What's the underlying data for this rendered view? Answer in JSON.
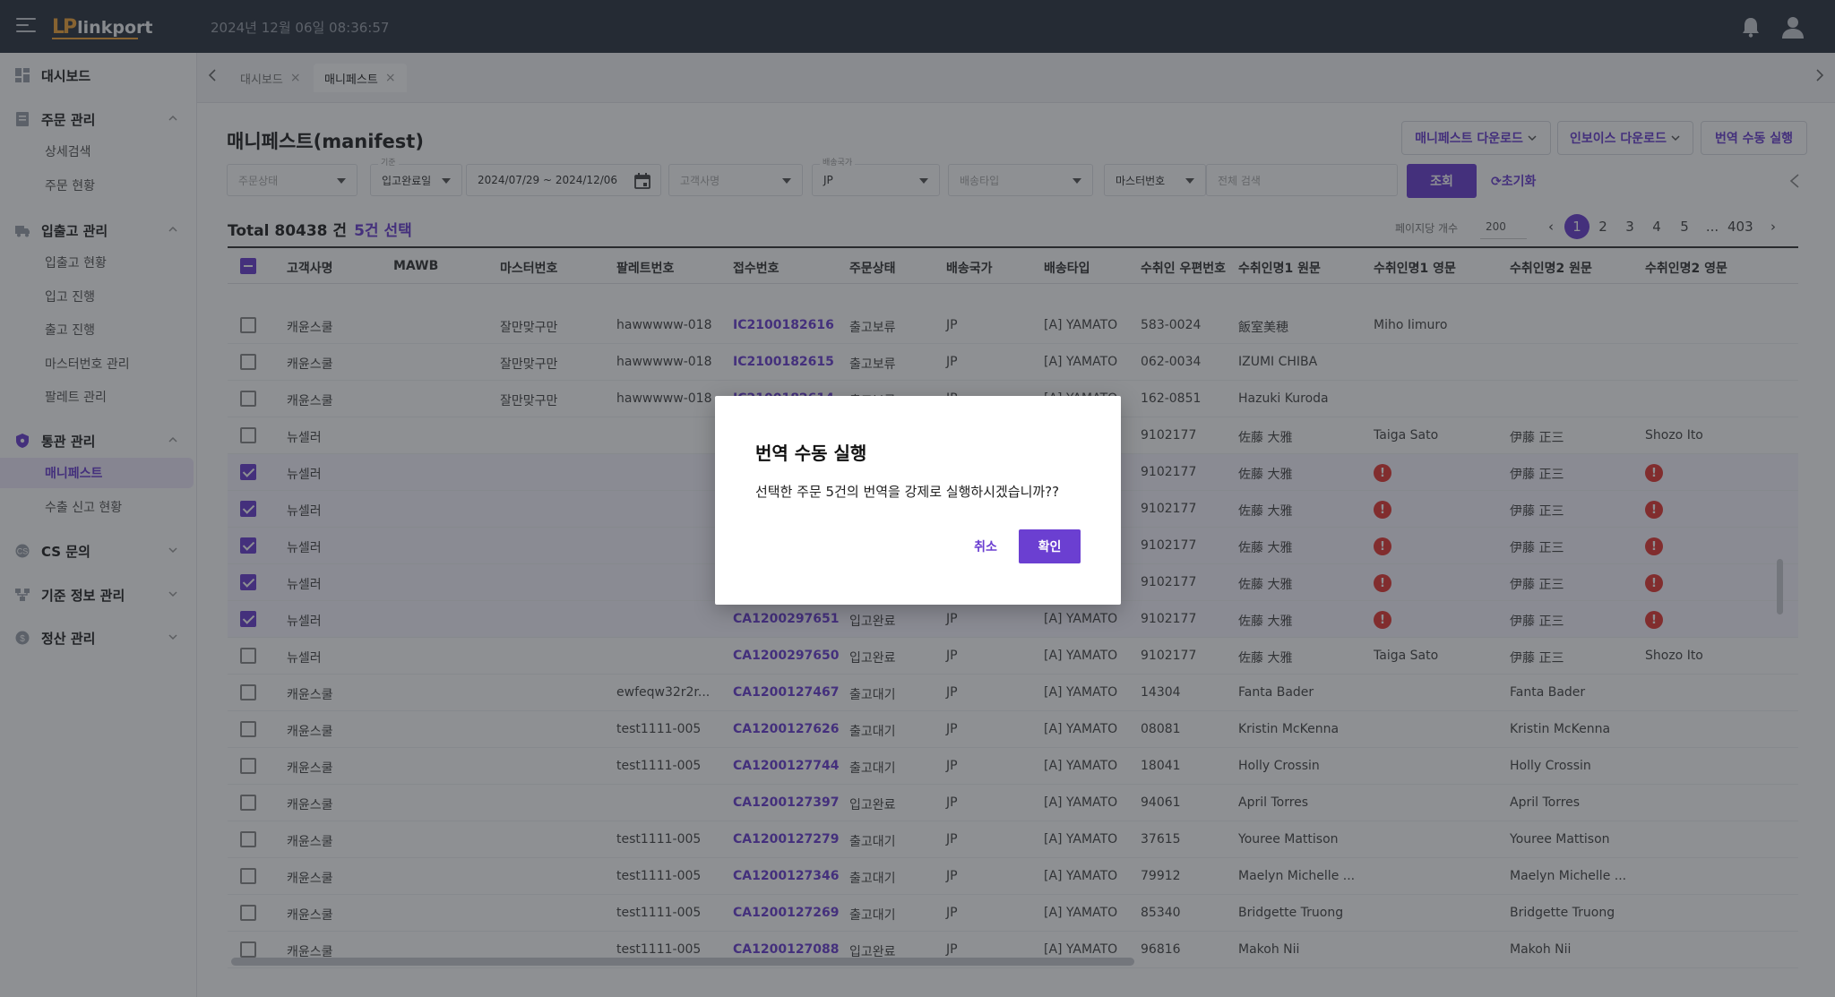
{
  "header": {
    "logo_mark": "LP",
    "logo_text": "linkport",
    "datetime": "2024년 12월 06일 08:36:57"
  },
  "sidebar": {
    "groups": [
      {
        "label": "대시보드",
        "icon": "dashboard-icon"
      },
      {
        "label": "주문 관리",
        "icon": "order-icon",
        "subs": [
          "상세검색",
          "주문 현황"
        ]
      },
      {
        "label": "입출고 관리",
        "icon": "truck-icon",
        "subs": [
          "입출고 현황",
          "입고 진행",
          "출고 진행",
          "마스터번호 관리",
          "팔레트 관리"
        ]
      },
      {
        "label": "통관 관리",
        "icon": "shield-icon",
        "subs": [
          "매니페스트",
          "수출 신고 현황"
        ]
      },
      {
        "label": "CS 문의",
        "icon": "cs-icon"
      },
      {
        "label": "기준 정보 관리",
        "icon": "settings-icon"
      },
      {
        "label": "정산 관리",
        "icon": "money-icon"
      }
    ]
  },
  "tabs": [
    {
      "label": "대시보드"
    },
    {
      "label": "매니페스트"
    }
  ],
  "page": {
    "title": "매니페스트(manifest)",
    "btn_manifest_download": "매니페스트 다운로드",
    "btn_invoice_download": "인보이스 다운로드",
    "btn_manual_translate": "번역 수동 실행"
  },
  "filters": {
    "order_status_placeholder": "주문상태",
    "date_type_label": "기준",
    "date_type": "입고완료일",
    "date_range": "2024/07/29 ~ 2024/12/06",
    "customer_placeholder": "고객사명",
    "country_label": "배송국가",
    "country": "JP",
    "delivery_type_placeholder": "배송타입",
    "search_field": "마스터번호",
    "search_placeholder": "전체 검색",
    "search_button": "조회",
    "reset_button": "초기화"
  },
  "summary": {
    "total": "Total 80438 건",
    "selected": "5건 선택"
  },
  "pagination": {
    "per_page_label": "페이지당 개수",
    "per_page": "200",
    "pages": [
      "1",
      "2",
      "3",
      "4",
      "5",
      "...",
      "403"
    ],
    "current": "1"
  },
  "table": {
    "columns": [
      "고객사명",
      "MAWB",
      "마스터번호",
      "팔레트번호",
      "접수번호",
      "주문상태",
      "배송국가",
      "배송타입",
      "수취인 우편번호",
      "수취인명1 원문",
      "수취인명1 영문",
      "수취인명2 원문",
      "수취인명2 영문"
    ],
    "rows": [
      {
        "checked": false,
        "customer": "캐윤스쿨",
        "master": "잘만맞구만",
        "pallet": "hawwwww-018",
        "receipt": "IC2100182616",
        "status": "출고보류",
        "country": "JP",
        "type": "[A] YAMATO",
        "zip": "583-0024",
        "name1": "飯室美穂",
        "name1_en": "Miho Iimuro",
        "name2": "",
        "name2_en": ""
      },
      {
        "checked": false,
        "customer": "캐윤스쿨",
        "master": "잘만맞구만",
        "pallet": "hawwwww-018",
        "receipt": "IC2100182615",
        "status": "출고보류",
        "country": "JP",
        "type": "[A] YAMATO",
        "zip": "062-0034",
        "name1": "IZUMI CHIBA",
        "name1_en": "",
        "name2": "",
        "name2_en": ""
      },
      {
        "checked": false,
        "customer": "캐윤스쿨",
        "master": "잘만맞구만",
        "pallet": "hawwwww-018",
        "receipt": "IC2100182614",
        "status": "출고보류",
        "country": "JP",
        "type": "[A] YAMATO",
        "zip": "162-0851",
        "name1": "Hazuki Kuroda",
        "name1_en": "",
        "name2": "",
        "name2_en": ""
      },
      {
        "checked": false,
        "customer": "뉴셀러",
        "master": "",
        "pallet": "",
        "receipt": "",
        "status": "",
        "country": "",
        "type": "",
        "zip": "9102177",
        "name1": "佐藤 大雅",
        "name1_en": "Taiga Sato",
        "name2": "伊藤 正三",
        "name2_en": "Shozo Ito"
      },
      {
        "checked": true,
        "customer": "뉴셀러",
        "master": "",
        "pallet": "",
        "receipt": "",
        "status": "",
        "country": "",
        "type": "",
        "zip": "9102177",
        "name1": "佐藤 大雅",
        "name1_en": "!",
        "name2": "伊藤 正三",
        "name2_en": "!"
      },
      {
        "checked": true,
        "customer": "뉴셀러",
        "master": "",
        "pallet": "",
        "receipt": "",
        "status": "",
        "country": "",
        "type": "",
        "zip": "9102177",
        "name1": "佐藤 大雅",
        "name1_en": "!",
        "name2": "伊藤 正三",
        "name2_en": "!"
      },
      {
        "checked": true,
        "customer": "뉴셀러",
        "master": "",
        "pallet": "",
        "receipt": "",
        "status": "",
        "country": "",
        "type": "",
        "zip": "9102177",
        "name1": "佐藤 大雅",
        "name1_en": "!",
        "name2": "伊藤 正三",
        "name2_en": "!"
      },
      {
        "checked": true,
        "customer": "뉴셀러",
        "master": "",
        "pallet": "",
        "receipt": "",
        "status": "",
        "country": "",
        "type": "",
        "zip": "9102177",
        "name1": "佐藤 大雅",
        "name1_en": "!",
        "name2": "伊藤 正三",
        "name2_en": "!"
      },
      {
        "checked": true,
        "customer": "뉴셀러",
        "master": "",
        "pallet": "",
        "receipt": "CA1200297651",
        "status": "입고완료",
        "country": "JP",
        "type": "[A] YAMATO",
        "zip": "9102177",
        "name1": "佐藤 大雅",
        "name1_en": "!",
        "name2": "伊藤 正三",
        "name2_en": "!"
      },
      {
        "checked": false,
        "customer": "뉴셀러",
        "master": "",
        "pallet": "",
        "receipt": "CA1200297650",
        "status": "입고완료",
        "country": "JP",
        "type": "[A] YAMATO",
        "zip": "9102177",
        "name1": "佐藤 大雅",
        "name1_en": "Taiga Sato",
        "name2": "伊藤 正三",
        "name2_en": "Shozo Ito"
      },
      {
        "checked": false,
        "customer": "캐윤스쿨",
        "master": "",
        "pallet": "ewfeqw32r2r...",
        "receipt": "CA1200127467",
        "status": "출고대기",
        "country": "JP",
        "type": "[A] YAMATO",
        "zip": "14304",
        "name1": "Fanta Bader",
        "name1_en": "",
        "name2": "Fanta Bader",
        "name2_en": ""
      },
      {
        "checked": false,
        "customer": "캐윤스쿨",
        "master": "",
        "pallet": "test1111-005",
        "receipt": "CA1200127626",
        "status": "출고대기",
        "country": "JP",
        "type": "[A] YAMATO",
        "zip": "08081",
        "name1": "Kristin McKenna",
        "name1_en": "",
        "name2": "Kristin McKenna",
        "name2_en": ""
      },
      {
        "checked": false,
        "customer": "캐윤스쿨",
        "master": "",
        "pallet": "test1111-005",
        "receipt": "CA1200127744",
        "status": "출고대기",
        "country": "JP",
        "type": "[A] YAMATO",
        "zip": "18041",
        "name1": "Holly Crossin",
        "name1_en": "",
        "name2": "Holly Crossin",
        "name2_en": ""
      },
      {
        "checked": false,
        "customer": "캐윤스쿨",
        "master": "",
        "pallet": "",
        "receipt": "CA1200127397",
        "status": "입고완료",
        "country": "JP",
        "type": "[A] YAMATO",
        "zip": "94061",
        "name1": "April Torres",
        "name1_en": "",
        "name2": "April Torres",
        "name2_en": ""
      },
      {
        "checked": false,
        "customer": "캐윤스쿨",
        "master": "",
        "pallet": "test1111-005",
        "receipt": "CA1200127279",
        "status": "출고대기",
        "country": "JP",
        "type": "[A] YAMATO",
        "zip": "37615",
        "name1": "Youree Mattison",
        "name1_en": "",
        "name2": "Youree Mattison",
        "name2_en": ""
      },
      {
        "checked": false,
        "customer": "캐윤스쿨",
        "master": "",
        "pallet": "test1111-005",
        "receipt": "CA1200127346",
        "status": "출고대기",
        "country": "JP",
        "type": "[A] YAMATO",
        "zip": "79912",
        "name1": "Maelyn Michelle ...",
        "name1_en": "",
        "name2": "Maelyn Michelle ...",
        "name2_en": ""
      },
      {
        "checked": false,
        "customer": "캐윤스쿨",
        "master": "",
        "pallet": "test1111-005",
        "receipt": "CA1200127269",
        "status": "출고대기",
        "country": "JP",
        "type": "[A] YAMATO",
        "zip": "85340",
        "name1": "Bridgette Truong",
        "name1_en": "",
        "name2": "Bridgette Truong",
        "name2_en": ""
      },
      {
        "checked": false,
        "customer": "캐윤스쿨",
        "master": "",
        "pallet": "test1111-005",
        "receipt": "CA1200127088",
        "status": "입고완료",
        "country": "JP",
        "type": "[A] YAMATO",
        "zip": "96816",
        "name1": "Makoh Nii",
        "name1_en": "",
        "name2": "Makoh Nii",
        "name2_en": ""
      }
    ]
  },
  "modal": {
    "title": "번역 수동 실행",
    "message": "선택한 주문 5건의 번역을 강제로 실행하시겠습니까??",
    "cancel": "취소",
    "confirm": "확인"
  },
  "colors": {
    "accent": "#6b3fd1",
    "topbar": "#2d3441",
    "logo": "#f0a53a",
    "error": "#e53935"
  }
}
